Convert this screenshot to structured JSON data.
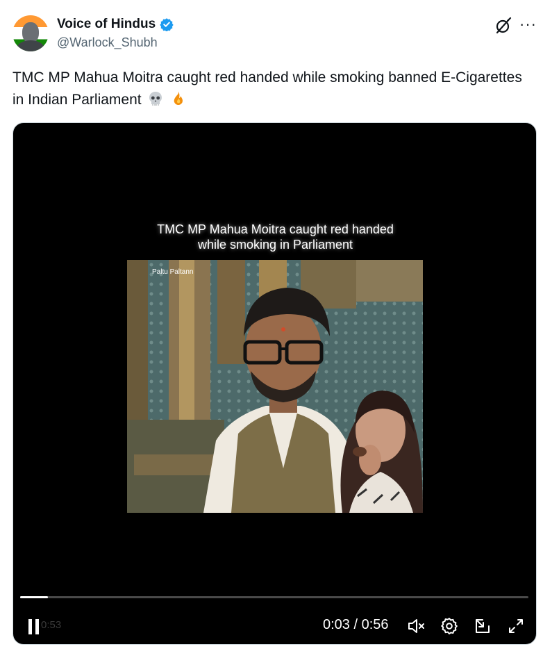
{
  "author": {
    "name": "Voice of Hindus",
    "handle": "@Warlock_Shubh",
    "verified": true
  },
  "tweet": {
    "text": "TMC MP Mahua Moitra caught red handed while smoking banned E-Cigarettes in Indian Parliament",
    "emojis": [
      "skull-emoji",
      "fire-emoji"
    ]
  },
  "video": {
    "caption_line1": "TMC MP Mahua Moitra caught red handed",
    "caption_line2": "while smoking in Parliament",
    "watermark": "Paltu Paltann",
    "ghost_time": "0:53",
    "current_time": "0:03",
    "separator": " / ",
    "duration": "0:56",
    "progress": 0.054,
    "controls": [
      "pause-icon",
      "mute-icon",
      "settings-icon",
      "pip-icon",
      "fullscreen-icon"
    ]
  },
  "colors": {
    "handle": "#536471",
    "verified": "#1d9bf0",
    "video_bg": "#000000"
  }
}
